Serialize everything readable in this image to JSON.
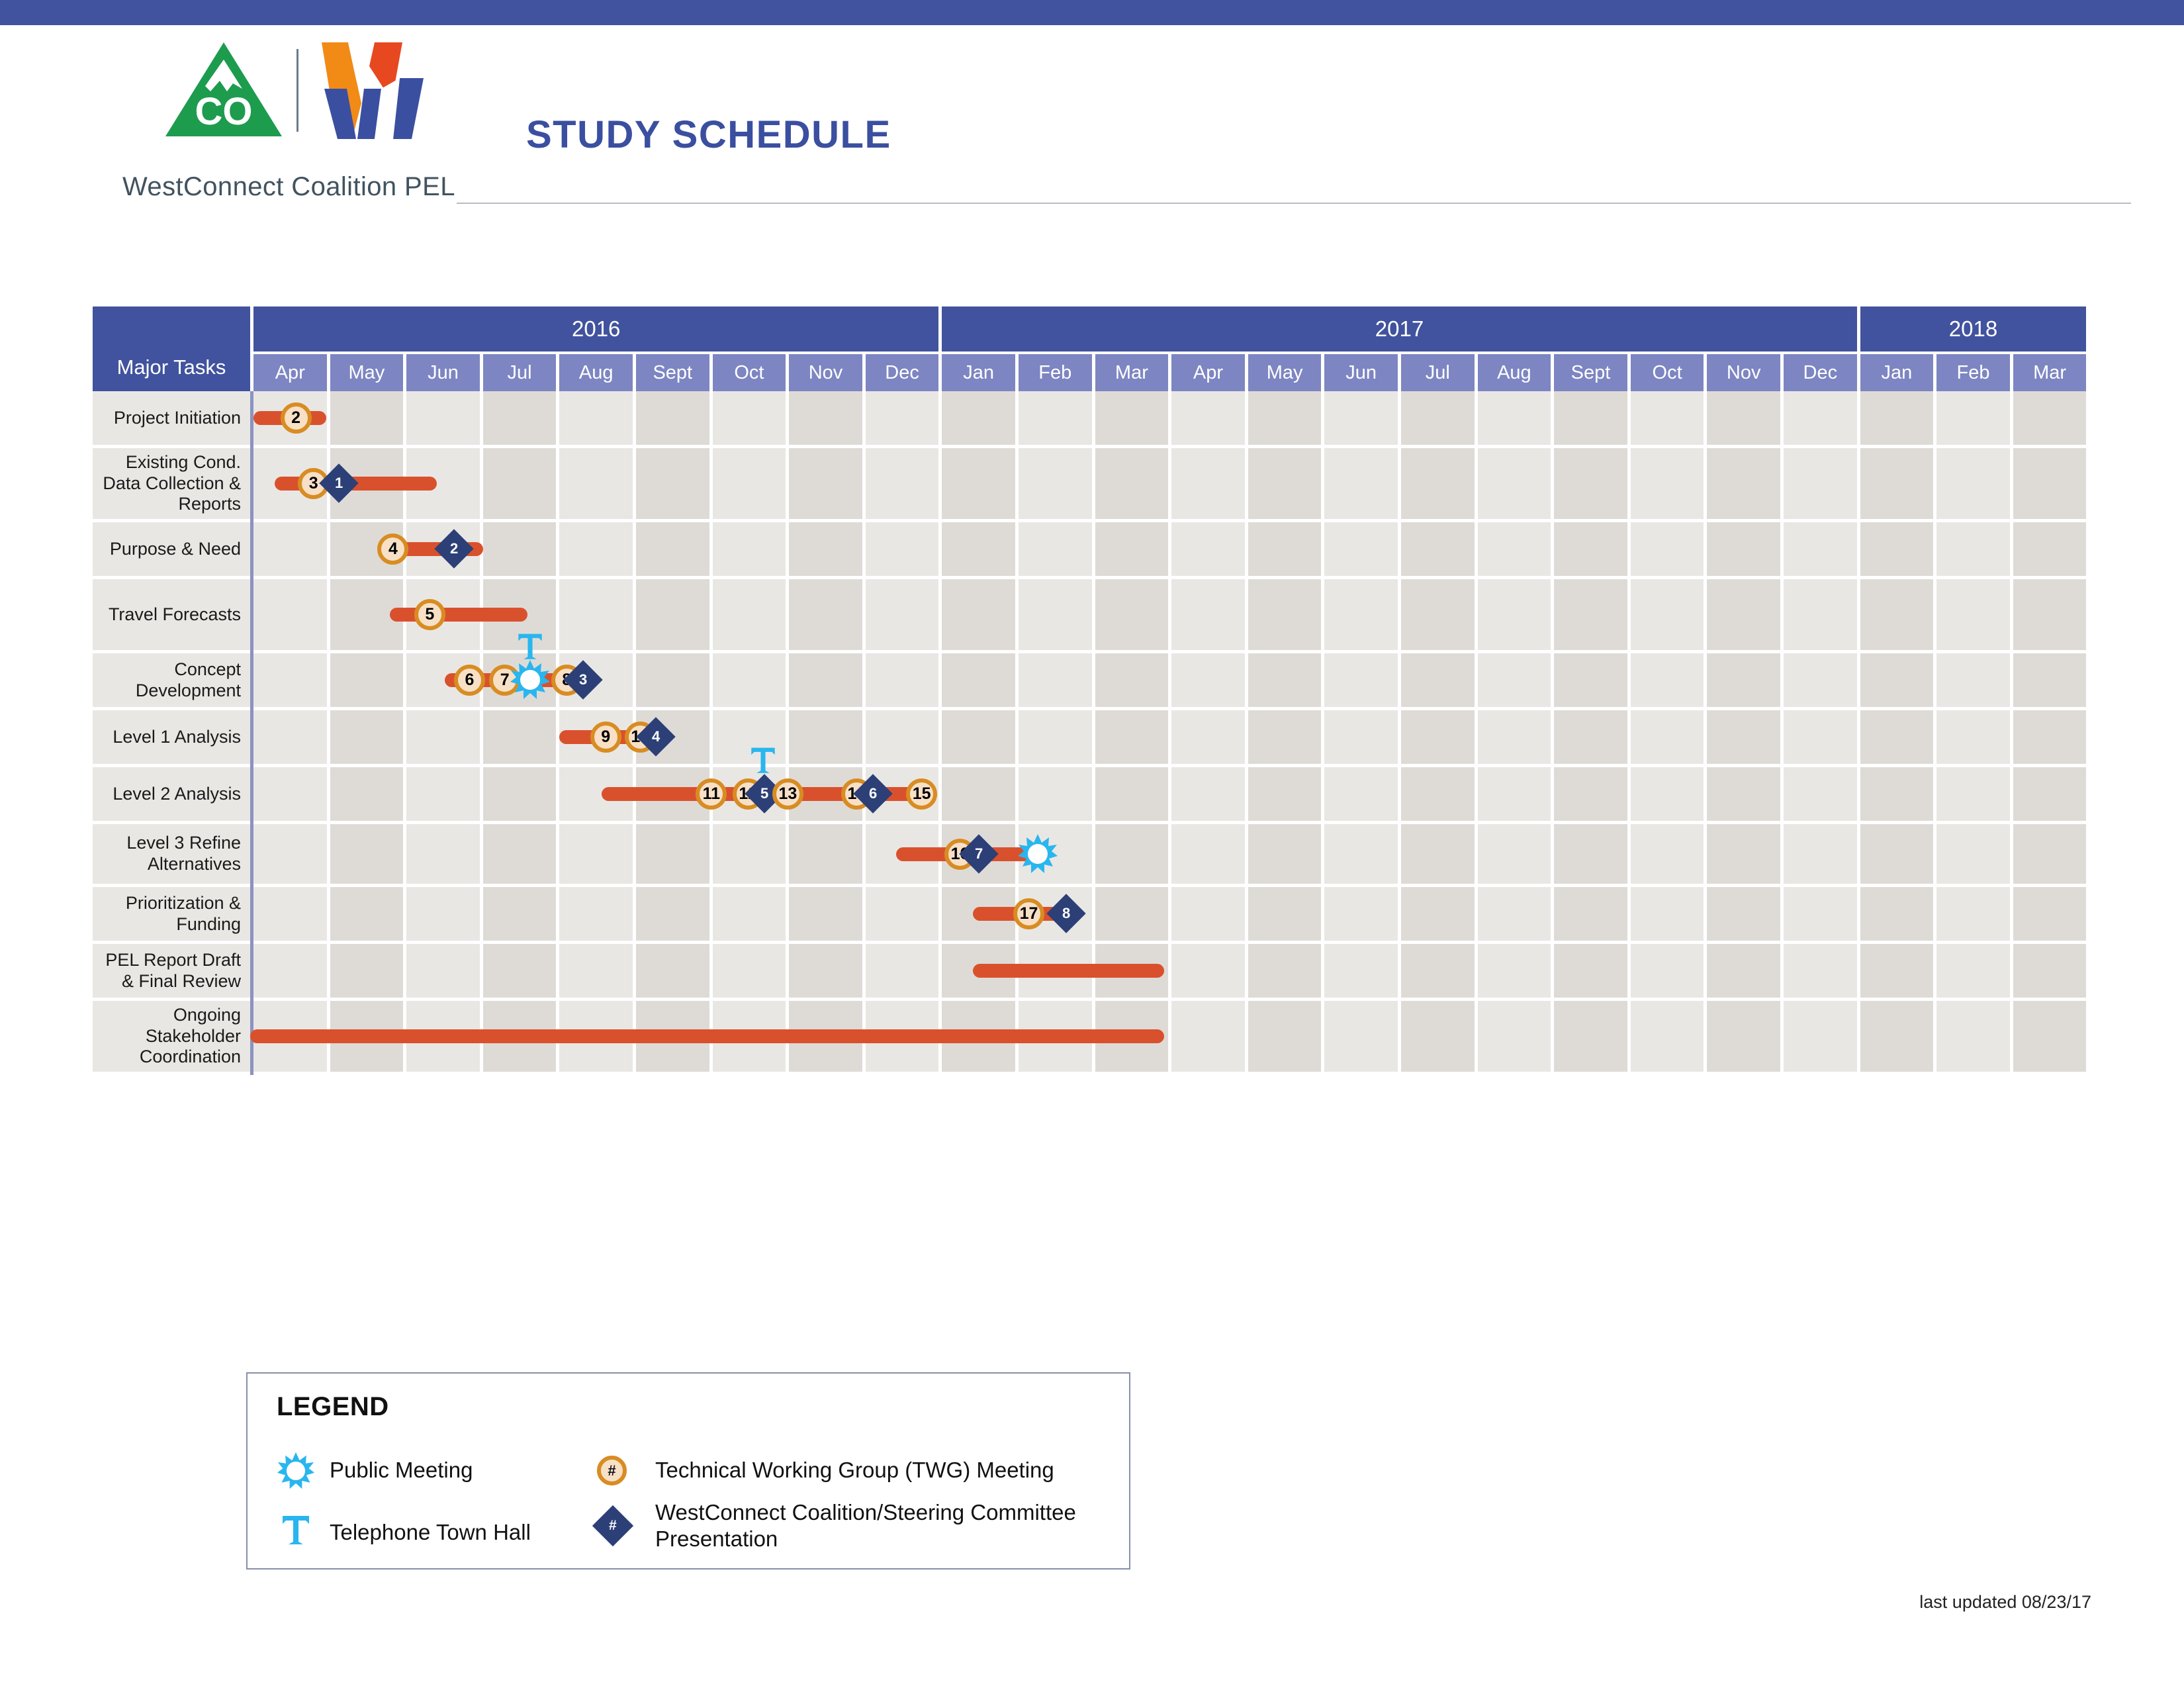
{
  "header": {
    "title": "STUDY SCHEDULE",
    "coalition_name": "WestConnect Coalition PEL",
    "logo_cdot_text": "CO",
    "brand_blue": "#41539e",
    "brand_orange": "#d9512c",
    "brand_green": "#1d9c4e"
  },
  "table": {
    "corner_label": "Major Tasks",
    "years": [
      {
        "label": "2016",
        "months": 9
      },
      {
        "label": "2017",
        "months": 12
      },
      {
        "label": "2018",
        "months": 3
      }
    ],
    "months": [
      "Apr",
      "May",
      "Jun",
      "Jul",
      "Aug",
      "Sept",
      "Oct",
      "Nov",
      "Dec",
      "Jan",
      "Feb",
      "Mar",
      "Apr",
      "May",
      "Jun",
      "Jul",
      "Aug",
      "Sept",
      "Oct",
      "Nov",
      "Dec",
      "Jan",
      "Feb",
      "Mar"
    ]
  },
  "chart_data": {
    "type": "bar",
    "title": "STUDY SCHEDULE",
    "xlabel": "",
    "ylabel": "Major Tasks",
    "x_axis_unit": "month",
    "x_tick_labels": [
      "Apr",
      "May",
      "Jun",
      "Jul",
      "Aug",
      "Sept",
      "Oct",
      "Nov",
      "Dec",
      "Jan",
      "Feb",
      "Mar",
      "Apr",
      "May",
      "Jun",
      "Jul",
      "Aug",
      "Sept",
      "Oct",
      "Nov",
      "Dec",
      "Jan",
      "Feb",
      "Mar"
    ],
    "x_group_labels": [
      "2016",
      "2017",
      "2018"
    ],
    "grid": true,
    "legend_position": "below",
    "tasks": [
      {
        "name": "Project Initiation",
        "start_month_index": 0,
        "end_month_index": 0.95,
        "markers": [
          {
            "kind": "twg",
            "label": "2",
            "month_index": 0.55
          }
        ]
      },
      {
        "name": "Existing Cond. Data Collection & Reports",
        "start_month_index": 0.28,
        "end_month_index": 2.4,
        "markers": [
          {
            "kind": "twg",
            "label": "3",
            "month_index": 0.78
          },
          {
            "kind": "milestone",
            "label": "1",
            "month_index": 1.12
          }
        ]
      },
      {
        "name": "Purpose & Need",
        "start_month_index": 1.65,
        "end_month_index": 3.0,
        "markers": [
          {
            "kind": "twg",
            "label": "4",
            "month_index": 1.82
          },
          {
            "kind": "milestone",
            "label": "2",
            "month_index": 2.62
          }
        ]
      },
      {
        "name": "Travel Forecasts",
        "start_month_index": 1.78,
        "end_month_index": 3.58,
        "markers": [
          {
            "kind": "twg",
            "label": "5",
            "month_index": 2.3
          }
        ]
      },
      {
        "name": "Concept Development",
        "start_month_index": 2.5,
        "end_month_index": 4.4,
        "markers": [
          {
            "kind": "twg",
            "label": "6",
            "month_index": 2.82
          },
          {
            "kind": "twg",
            "label": "7",
            "month_index": 3.28
          },
          {
            "kind": "townhall",
            "label": "",
            "month_index": 3.62
          },
          {
            "kind": "public",
            "label": "",
            "month_index": 3.62
          },
          {
            "kind": "twg",
            "label": "8",
            "month_index": 4.09
          },
          {
            "kind": "milestone",
            "label": "3",
            "month_index": 4.31
          }
        ]
      },
      {
        "name": "Level 1 Analysis",
        "start_month_index": 4.0,
        "end_month_index": 5.4,
        "markers": [
          {
            "kind": "twg",
            "label": "9",
            "month_index": 4.6
          },
          {
            "kind": "twg",
            "label": "10",
            "month_index": 5.05
          },
          {
            "kind": "milestone",
            "label": "4",
            "month_index": 5.26
          }
        ]
      },
      {
        "name": "Level 2 Analysis",
        "start_month_index": 4.55,
        "end_month_index": 8.9,
        "markers": [
          {
            "kind": "twg",
            "label": "11",
            "month_index": 5.98
          },
          {
            "kind": "twg",
            "label": "12",
            "month_index": 6.46
          },
          {
            "kind": "townhall",
            "label": "",
            "month_index": 6.66
          },
          {
            "kind": "milestone",
            "label": "5",
            "month_index": 6.68
          },
          {
            "kind": "twg",
            "label": "13",
            "month_index": 6.98
          },
          {
            "kind": "twg",
            "label": "14",
            "month_index": 7.88
          },
          {
            "kind": "milestone",
            "label": "6",
            "month_index": 8.1
          },
          {
            "kind": "twg",
            "label": "15",
            "month_index": 8.73
          }
        ]
      },
      {
        "name": "Level 3 Refine Alternatives",
        "start_month_index": 8.4,
        "end_month_index": 10.3,
        "markers": [
          {
            "kind": "twg",
            "label": "16",
            "month_index": 9.23
          },
          {
            "kind": "milestone",
            "label": "7",
            "month_index": 9.48
          },
          {
            "kind": "public",
            "label": "",
            "month_index": 10.25
          }
        ]
      },
      {
        "name": "Prioritization & Funding",
        "start_month_index": 9.4,
        "end_month_index": 10.6,
        "markers": [
          {
            "kind": "twg",
            "label": "17",
            "month_index": 10.13
          },
          {
            "kind": "milestone",
            "label": "8",
            "month_index": 10.62
          }
        ]
      },
      {
        "name": "PEL Report Draft & Final Review",
        "start_month_index": 9.4,
        "end_month_index": 11.9,
        "markers": []
      },
      {
        "name": "Ongoing Stakeholder Coordination",
        "start_month_index": -0.2,
        "end_month_index": 11.9,
        "markers": []
      }
    ]
  },
  "legend": {
    "title": "LEGEND",
    "items": [
      {
        "icon": "public-meeting-icon",
        "label": "Public Meeting"
      },
      {
        "icon": "telephone-town-hall-icon",
        "label": "Telephone Town Hall"
      },
      {
        "icon": "twg-meeting-icon",
        "symbol": "#",
        "label": "Technical Working Group (TWG) Meeting"
      },
      {
        "icon": "coalition-presentation-icon",
        "symbol": "#",
        "label": "WestConnect Coalition/Steering Committee Presentation"
      }
    ]
  },
  "footer": {
    "last_updated": "last updated 08/23/17"
  }
}
